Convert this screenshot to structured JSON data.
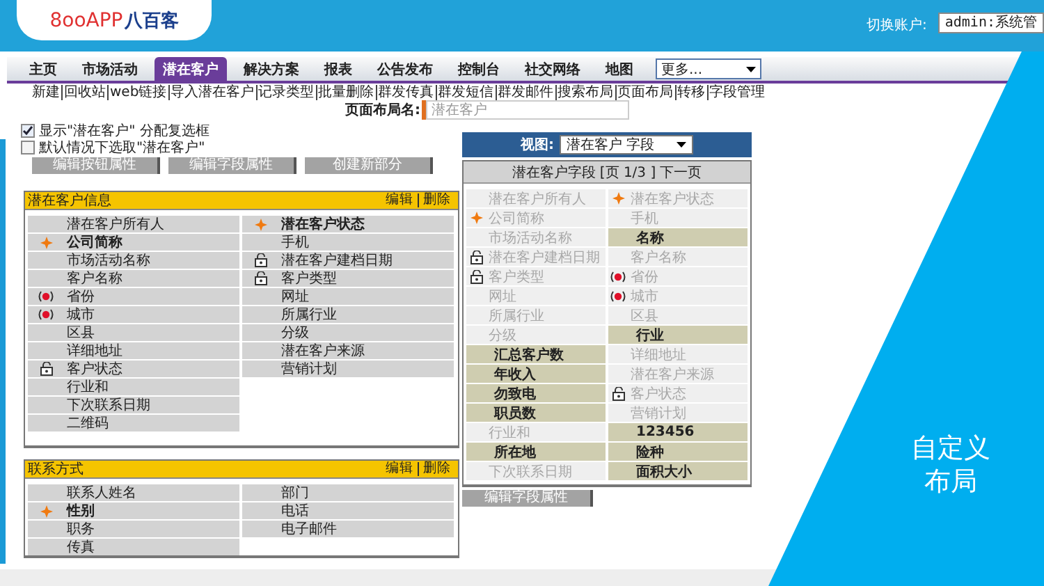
{
  "header": {
    "logo": {
      "brand": "8ooAPP",
      "name": "八百客"
    },
    "account_label": "切换账户:",
    "account": "admin:系统管"
  },
  "tabs": [
    {
      "label": "主页",
      "selected": false
    },
    {
      "label": "市场活动",
      "selected": false
    },
    {
      "label": "潜在客户",
      "selected": true
    },
    {
      "label": "解决方案",
      "selected": false
    },
    {
      "label": "报表",
      "selected": false
    },
    {
      "label": "公告发布",
      "selected": false
    },
    {
      "label": "控制台",
      "selected": false
    },
    {
      "label": "社交网络",
      "selected": false
    },
    {
      "label": "地图",
      "selected": false
    }
  ],
  "more_select": "更多...",
  "sub_links": [
    "新建",
    "回收站",
    "web链接",
    "导入潜在客户",
    "记录类型",
    "批量删除",
    "群发传真",
    "群发短信",
    "群发邮件",
    "搜索布局",
    "页面布局",
    "转移",
    "字段管理"
  ],
  "layout_name": {
    "label": "页面布局名:",
    "placeholder": "潜在客户"
  },
  "options": [
    {
      "label": "显示\"潜在客户\" 分配复选框",
      "checked": true
    },
    {
      "label": "默认情况下选取\"潜在客户\"",
      "checked": false
    }
  ],
  "buttons": [
    "编辑按钮属性",
    "编辑字段属性",
    "创建新部分"
  ],
  "sections": [
    {
      "title": "潜在客户信息",
      "actions": [
        "编辑",
        "删除"
      ],
      "columns": [
        [
          {
            "label": "潜在客户所有人",
            "kind": "plain"
          },
          {
            "label": "公司简称",
            "kind": "required"
          },
          {
            "label": "市场活动名称",
            "kind": "plain"
          },
          {
            "label": "客户名称",
            "kind": "plain"
          },
          {
            "label": "省份",
            "kind": "picklist"
          },
          {
            "label": "城市",
            "kind": "picklist"
          },
          {
            "label": "区县",
            "kind": "plain"
          },
          {
            "label": "详细地址",
            "kind": "plain"
          },
          {
            "label": "客户状态",
            "kind": "lock"
          },
          {
            "label": "行业和",
            "kind": "plain"
          },
          {
            "label": "下次联系日期",
            "kind": "plain"
          },
          {
            "label": "二维码",
            "kind": "plain"
          }
        ],
        [
          {
            "label": "潜在客户状态",
            "kind": "required"
          },
          {
            "label": "手机",
            "kind": "plain"
          },
          {
            "label": "潜在客户建档日期",
            "kind": "lock"
          },
          {
            "label": "客户类型",
            "kind": "lock"
          },
          {
            "label": "网址",
            "kind": "plain"
          },
          {
            "label": "所属行业",
            "kind": "plain"
          },
          {
            "label": "分级",
            "kind": "plain"
          },
          {
            "label": "潜在客户来源",
            "kind": "plain"
          },
          {
            "label": "营销计划",
            "kind": "plain"
          }
        ]
      ]
    },
    {
      "title": "联系方式",
      "actions": [
        "编辑",
        "删除"
      ],
      "columns": [
        [
          {
            "label": "联系人姓名",
            "kind": "plain"
          },
          {
            "label": "性别",
            "kind": "required"
          },
          {
            "label": "职务",
            "kind": "plain"
          },
          {
            "label": "传真",
            "kind": "plain"
          }
        ],
        [
          {
            "label": "部门",
            "kind": "plain"
          },
          {
            "label": "电话",
            "kind": "plain"
          },
          {
            "label": "电子邮件",
            "kind": "plain"
          }
        ]
      ]
    }
  ],
  "palette": {
    "view_label": "视图:",
    "view": "潜在客户 字段",
    "title": "潜在客户字段",
    "page": "[页 1/3 ]",
    "next": "下一页",
    "items": [
      {
        "label": "潜在客户所有人",
        "kind": "plain",
        "in_layout": true
      },
      {
        "label": "潜在客户状态",
        "kind": "required",
        "in_layout": true
      },
      {
        "label": "公司简称",
        "kind": "required",
        "in_layout": true
      },
      {
        "label": "手机",
        "kind": "plain",
        "in_layout": true
      },
      {
        "label": "市场活动名称",
        "kind": "plain",
        "in_layout": true
      },
      {
        "label": "名称",
        "kind": "plain",
        "in_layout": false
      },
      {
        "label": "潜在客户建档日期",
        "kind": "lock",
        "in_layout": true
      },
      {
        "label": "客户名称",
        "kind": "plain",
        "in_layout": true
      },
      {
        "label": "客户类型",
        "kind": "lock",
        "in_layout": true
      },
      {
        "label": "省份",
        "kind": "picklist",
        "in_layout": true
      },
      {
        "label": "网址",
        "kind": "plain",
        "in_layout": true
      },
      {
        "label": "城市",
        "kind": "picklist",
        "in_layout": true
      },
      {
        "label": "所属行业",
        "kind": "plain",
        "in_layout": true
      },
      {
        "label": "区县",
        "kind": "plain",
        "in_layout": true
      },
      {
        "label": "分级",
        "kind": "plain",
        "in_layout": true
      },
      {
        "label": "行业",
        "kind": "plain",
        "in_layout": false
      },
      {
        "label": "汇总客户数",
        "kind": "plain",
        "in_layout": false
      },
      {
        "label": "详细地址",
        "kind": "plain",
        "in_layout": true
      },
      {
        "label": "年收入",
        "kind": "plain",
        "in_layout": false
      },
      {
        "label": "潜在客户来源",
        "kind": "plain",
        "in_layout": true
      },
      {
        "label": "勿致电",
        "kind": "plain",
        "in_layout": false
      },
      {
        "label": "客户状态",
        "kind": "lock",
        "in_layout": true
      },
      {
        "label": "职员数",
        "kind": "plain",
        "in_layout": false
      },
      {
        "label": "营销计划",
        "kind": "plain",
        "in_layout": true
      },
      {
        "label": "行业和",
        "kind": "plain",
        "in_layout": true
      },
      {
        "label": "123456",
        "kind": "plain",
        "in_layout": false
      },
      {
        "label": "所在地",
        "kind": "plain",
        "in_layout": false
      },
      {
        "label": "险种",
        "kind": "plain",
        "in_layout": false
      },
      {
        "label": "下次联系日期",
        "kind": "plain",
        "in_layout": true
      },
      {
        "label": "面积大小",
        "kind": "plain",
        "in_layout": false
      }
    ],
    "button": "编辑字段属性"
  },
  "slide_caption": [
    "自定义",
    "布局"
  ]
}
